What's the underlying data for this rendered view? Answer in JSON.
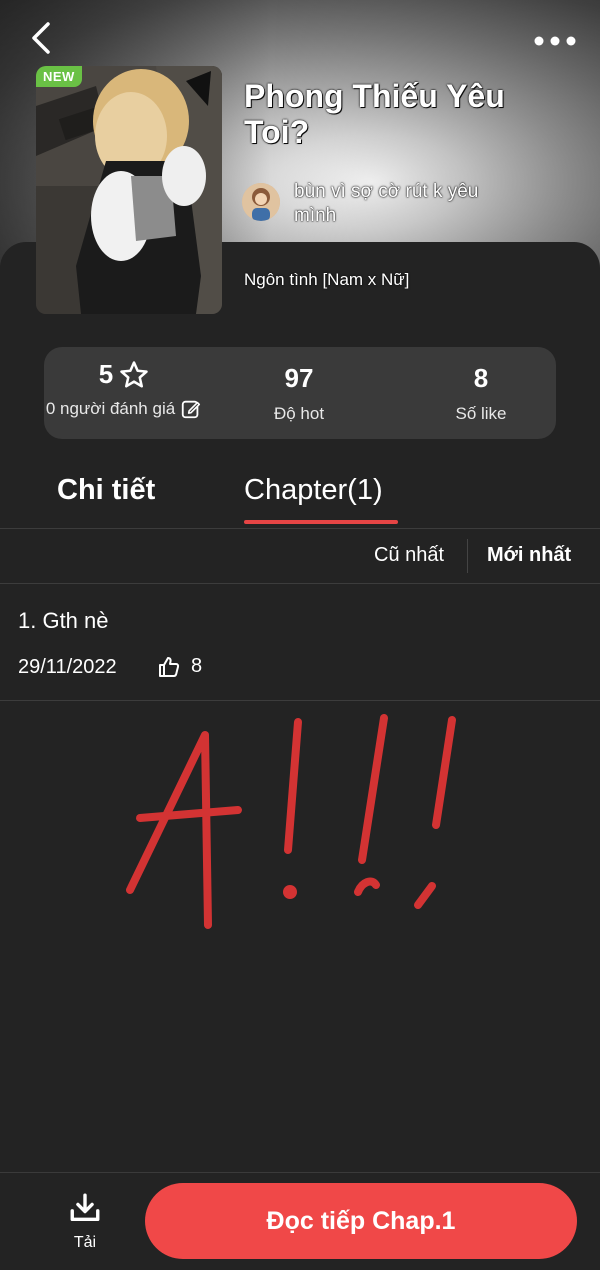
{
  "header": {
    "back_icon": "chevron-left-icon",
    "more_icon": "more-horizontal-icon"
  },
  "story": {
    "badge": "NEW",
    "title": "Phong Thiếu Yêu Toi?",
    "author": "bùn vì sợ cờ rút k yêu mình",
    "genre": "Ngôn tình [Nam x Nữ]"
  },
  "stats": {
    "rating_value": "5",
    "rating_label": "0 người đánh giá",
    "hot_value": "97",
    "hot_label": "Độ hot",
    "likes_value": "8",
    "likes_label": "Số like"
  },
  "tabs": {
    "details": "Chi tiết",
    "chapters": "Chapter(1)"
  },
  "sort": {
    "oldest": "Cũ nhất",
    "newest": "Mới nhất"
  },
  "chapters": [
    {
      "title": "1. Gth nè",
      "date": "29/11/2022",
      "likes": "8"
    }
  ],
  "bottom": {
    "download_label": "Tải",
    "read_button": "Đọc tiếp Chap.1"
  },
  "colors": {
    "accent": "#f04848",
    "new_badge": "#6ac145",
    "background": "#232323"
  }
}
